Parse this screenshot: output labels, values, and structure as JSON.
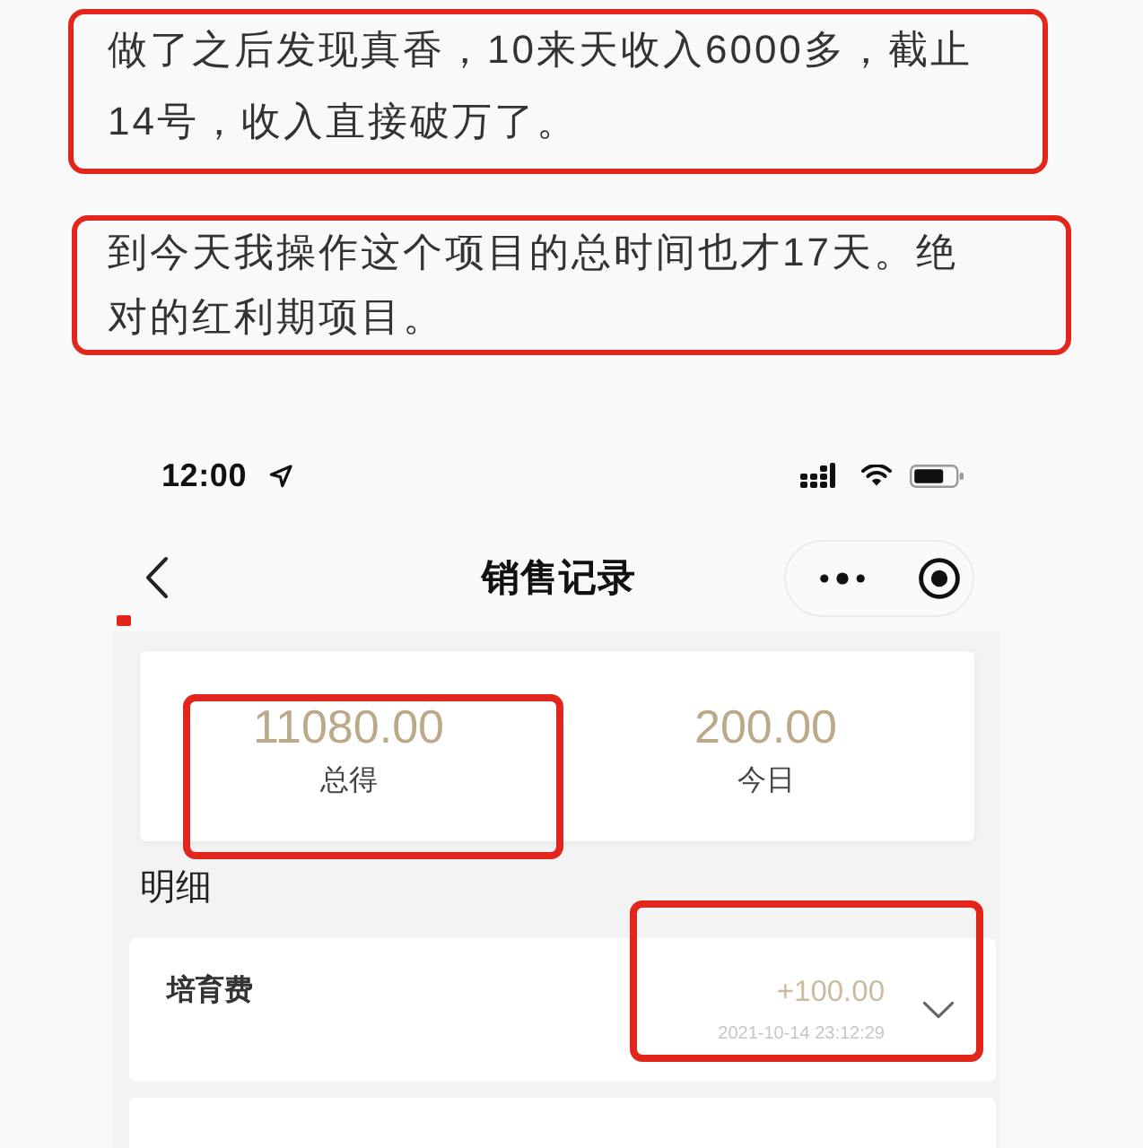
{
  "notes": [
    {
      "text": "做了之后发现真香，10来天收入6000多，截止14号，收入直接破万了。"
    },
    {
      "text": "到今天我操作这个项目的总时间也才17天。绝对的红利期项目。"
    }
  ],
  "phone": {
    "status_bar": {
      "time": "12:00"
    },
    "nav": {
      "title": "销售记录"
    },
    "summary": [
      {
        "amount": "11080.00",
        "label": "总得",
        "highlighted": true
      },
      {
        "amount": "200.00",
        "label": "今日",
        "highlighted": false
      }
    ],
    "detail_heading": "明细",
    "records": [
      {
        "name": "培育费",
        "amount": "+100.00",
        "time": "2021-10-14 23:12:29",
        "expanded": false,
        "highlighted": true
      }
    ]
  }
}
